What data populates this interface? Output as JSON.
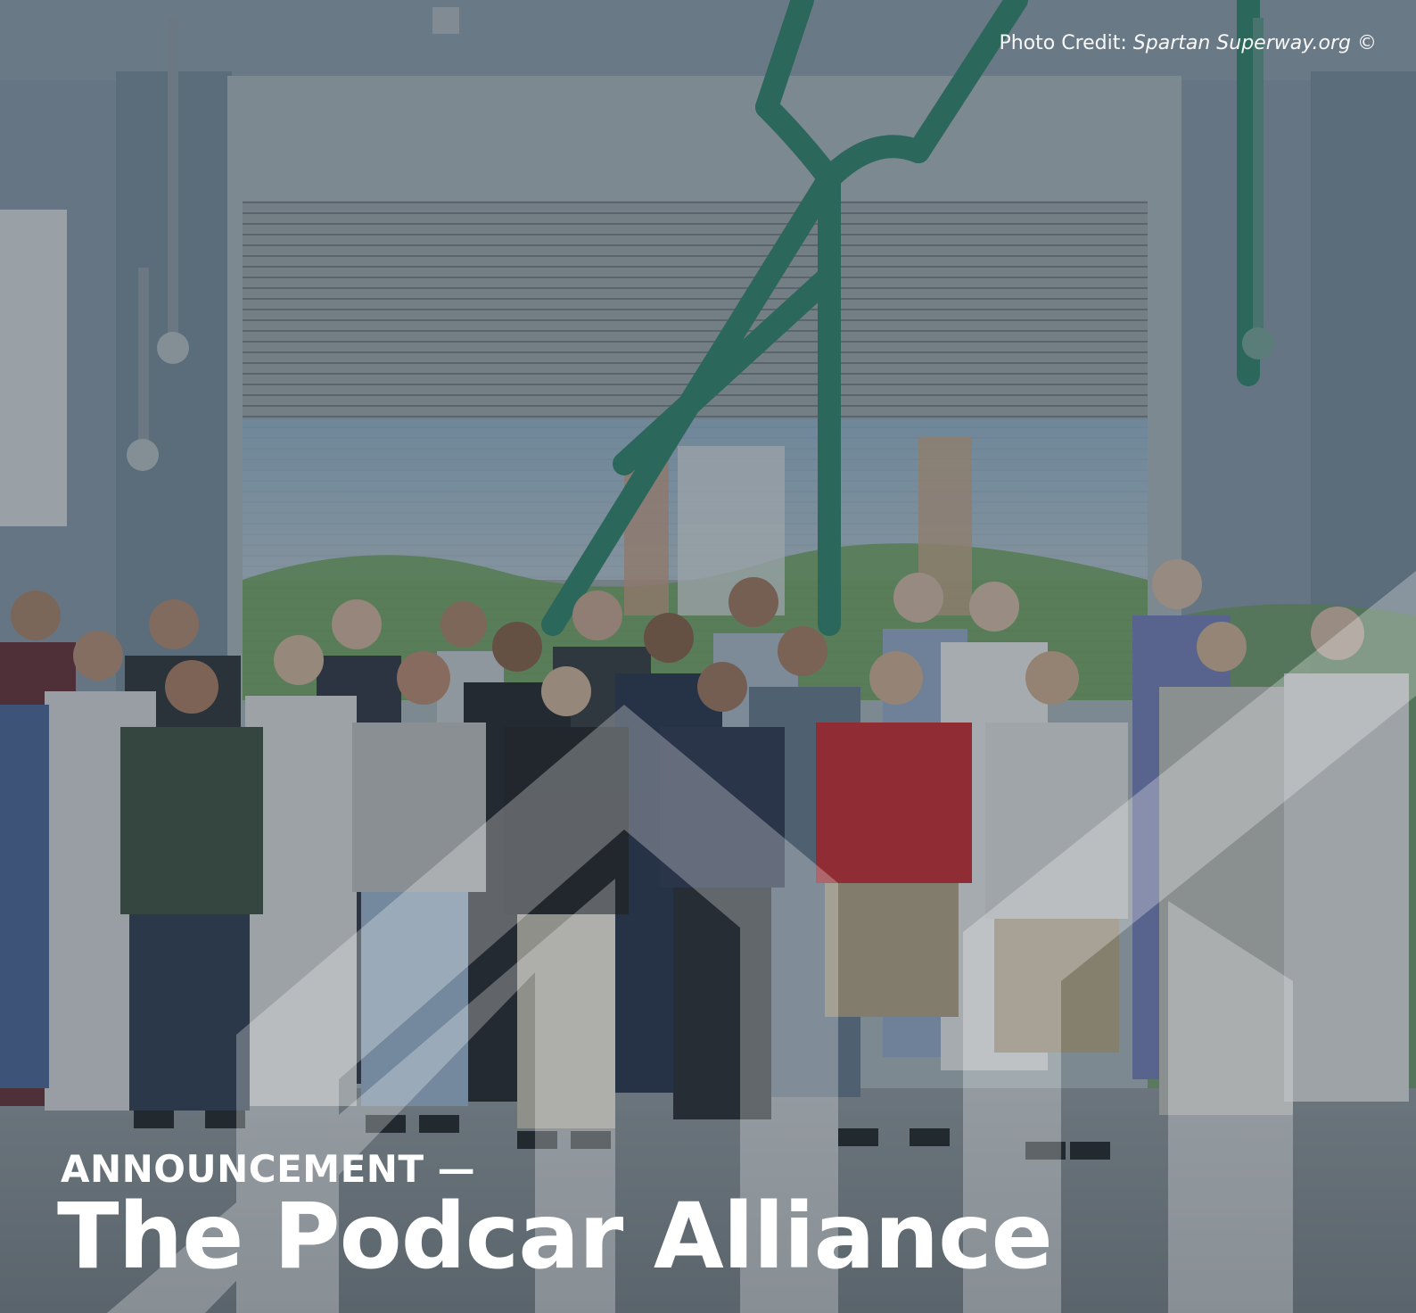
{
  "photo_credit": {
    "prefix": "Photo Credit: ",
    "source": "Spartan Superway.org ©"
  },
  "announcement": {
    "kicker": "ANNOUNCEMENT —",
    "title": "The Podcar Alliance"
  },
  "colors": {
    "overlay_tint": "#2a3640",
    "mural_green": "#2e8a6e",
    "wall": "#8fa3b3",
    "text": "#ffffff"
  }
}
